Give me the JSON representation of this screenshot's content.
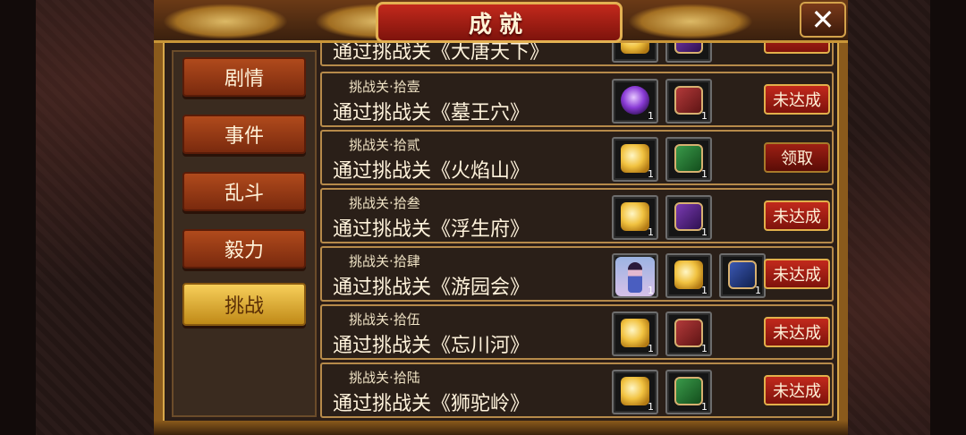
{
  "header": {
    "title": "成就",
    "close_label": "✕"
  },
  "sidebar": {
    "tabs": [
      {
        "label": "剧情"
      },
      {
        "label": "事件"
      },
      {
        "label": "乱斗"
      },
      {
        "label": "毅力"
      },
      {
        "label": "挑战"
      }
    ],
    "active_tab": "挑战"
  },
  "list": {
    "partial_row": {
      "main": "通过挑战关《大唐天下》"
    },
    "rows": [
      {
        "sub": "挑战关·拾壹",
        "main": "通过挑战关《墓王穴》",
        "rewards": [
          {
            "icon": "purple-orb-icon",
            "qty": "1"
          },
          {
            "icon": "red-book-icon",
            "qty": "1"
          }
        ],
        "action": "未达成"
      },
      {
        "sub": "挑战关·拾贰",
        "main": "通过挑战关《火焰山》",
        "rewards": [
          {
            "icon": "gold-ingot-icon",
            "qty": "1"
          },
          {
            "icon": "green-book-icon",
            "qty": "1"
          }
        ],
        "action": "领取"
      },
      {
        "sub": "挑战关·拾叁",
        "main": "通过挑战关《浮生府》",
        "rewards": [
          {
            "icon": "gold-ingot-icon",
            "qty": "1"
          },
          {
            "icon": "purple-book-icon",
            "qty": "1"
          }
        ],
        "action": "未达成"
      },
      {
        "sub": "挑战关·拾肆",
        "main": "通过挑战关《游园会》",
        "rewards": [
          {
            "icon": "hero-portrait-icon",
            "qty": "1"
          },
          {
            "icon": "gold-ingot-icon",
            "qty": "1"
          },
          {
            "icon": "blue-book-icon",
            "qty": "1"
          }
        ],
        "action": "未达成"
      },
      {
        "sub": "挑战关·拾伍",
        "main": "通过挑战关《忘川河》",
        "rewards": [
          {
            "icon": "gold-ingot-icon",
            "qty": "1"
          },
          {
            "icon": "red-book-icon",
            "qty": "1"
          }
        ],
        "action": "未达成"
      },
      {
        "sub": "挑战关·拾陆",
        "main": "通过挑战关《狮驼岭》",
        "rewards": [
          {
            "icon": "gold-ingot-icon",
            "qty": "1"
          },
          {
            "icon": "green-book-icon",
            "qty": "1"
          }
        ],
        "action": "未达成"
      }
    ]
  },
  "colors": {
    "frame_gold": "#d8a84a",
    "title_red": "#c2291c",
    "tab_active": "#f7cf5a",
    "tab_inactive": "#b04a1c"
  }
}
